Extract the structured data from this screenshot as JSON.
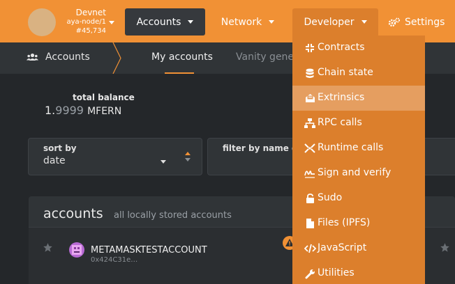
{
  "chain": {
    "name": "Devnet",
    "node": "aya-node/1",
    "block": "#45,734"
  },
  "nav": {
    "accounts": "Accounts",
    "network": "Network",
    "developer": "Developer",
    "settings": "Settings"
  },
  "subnav": {
    "section": "Accounts",
    "tabs": [
      "My accounts",
      "Vanity gener"
    ]
  },
  "balance": {
    "label": "total balance",
    "whole": "1.",
    "fraction": "9999",
    "unit": "MFERN"
  },
  "sort": {
    "label": "sort by",
    "value": "date"
  },
  "filter": {
    "label": "filter by name or"
  },
  "accounts_table": {
    "title": "accounts",
    "subtitle": "all locally stored accounts",
    "rows": [
      {
        "name": "METAMASKTESTACCOUNT",
        "address": "0x424C31e…"
      }
    ]
  },
  "developer_menu": {
    "selected_index": 2,
    "items": [
      {
        "label": "Contracts",
        "icon": "contracts-icon"
      },
      {
        "label": "Chain state",
        "icon": "database-icon"
      },
      {
        "label": "Extrinsics",
        "icon": "envelope-open-icon"
      },
      {
        "label": "RPC calls",
        "icon": "network-wired-icon"
      },
      {
        "label": "Runtime calls",
        "icon": "arrows-inward-icon"
      },
      {
        "label": "Sign and verify",
        "icon": "signature-icon"
      },
      {
        "label": "Sudo",
        "icon": "unlock-icon"
      },
      {
        "label": "Files (IPFS)",
        "icon": "file-icon"
      },
      {
        "label": "JavaScript",
        "icon": "code-icon"
      },
      {
        "label": "Utilities",
        "icon": "wrench-icon"
      }
    ]
  },
  "colors": {
    "accent": "#f19135",
    "menu_bg": "#dc7f2c",
    "menu_selected": "#e59e60",
    "page_bg": "#24272a"
  }
}
